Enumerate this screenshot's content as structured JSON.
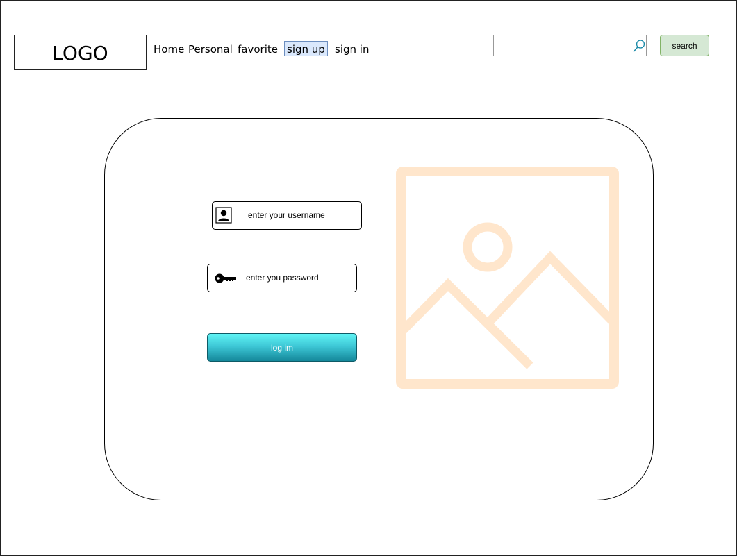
{
  "header": {
    "logo": "LOGO",
    "nav": {
      "home": "Home",
      "personal": "Personal",
      "favorite": "favorite",
      "sign_up": "sign up",
      "sign_in": "sign in"
    },
    "selected_nav": "sign up",
    "search": {
      "value": "",
      "placeholder": "",
      "button_label": "search",
      "icon": "search-icon"
    }
  },
  "login_form": {
    "username": {
      "placeholder": "enter your username",
      "icon": "user-icon"
    },
    "password": {
      "placeholder": "enter you password",
      "icon": "key-icon"
    },
    "submit_label": "log im"
  },
  "image": {
    "icon": "image-placeholder-icon"
  },
  "colors": {
    "selected_nav_fill": "#dae8fc",
    "selected_nav_border": "#6c8ebf",
    "search_button_fill": "#d5e8d4",
    "search_button_border": "#82b366",
    "login_button_top": "#5ff3f4",
    "login_button_bottom": "#14879a",
    "image_placeholder": "#ffe6cc",
    "search_icon": "#1a8aa8"
  }
}
